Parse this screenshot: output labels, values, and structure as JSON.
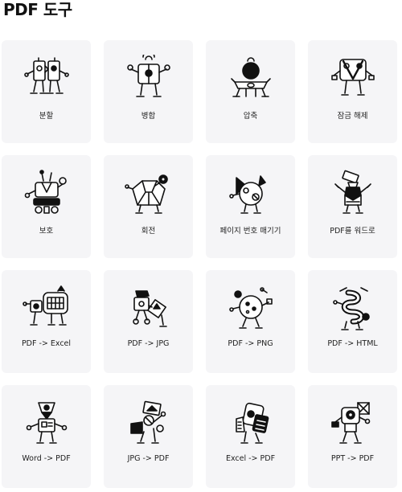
{
  "page": {
    "title": "PDF 도구"
  },
  "tools": [
    {
      "label": "분할",
      "icon": "robot-split-icon"
    },
    {
      "label": "병합",
      "icon": "robot-merge-icon"
    },
    {
      "label": "압축",
      "icon": "robot-compress-icon"
    },
    {
      "label": "잠금 해제",
      "icon": "robot-unlock-icon"
    },
    {
      "label": "보호",
      "icon": "robot-protect-icon"
    },
    {
      "label": "회전",
      "icon": "robot-rotate-icon"
    },
    {
      "label": "페이지 번호 매기기",
      "icon": "robot-page-numbers-icon"
    },
    {
      "label": "PDF를 워드로",
      "icon": "robot-pdf-to-word-icon"
    },
    {
      "label": "PDF -> Excel",
      "icon": "robot-pdf-to-excel-icon"
    },
    {
      "label": "PDF -> JPG",
      "icon": "robot-pdf-to-jpg-icon"
    },
    {
      "label": "PDF -> PNG",
      "icon": "robot-pdf-to-png-icon"
    },
    {
      "label": "PDF -> HTML",
      "icon": "robot-pdf-to-html-icon"
    },
    {
      "label": "Word -> PDF",
      "icon": "robot-word-to-pdf-icon"
    },
    {
      "label": "JPG -> PDF",
      "icon": "robot-jpg-to-pdf-icon"
    },
    {
      "label": "Excel -> PDF",
      "icon": "robot-excel-to-pdf-icon"
    },
    {
      "label": "PPT -> PDF",
      "icon": "robot-ppt-to-pdf-icon"
    }
  ],
  "colors": {
    "card_bg": "#f5f5f7",
    "ink": "#111111"
  }
}
